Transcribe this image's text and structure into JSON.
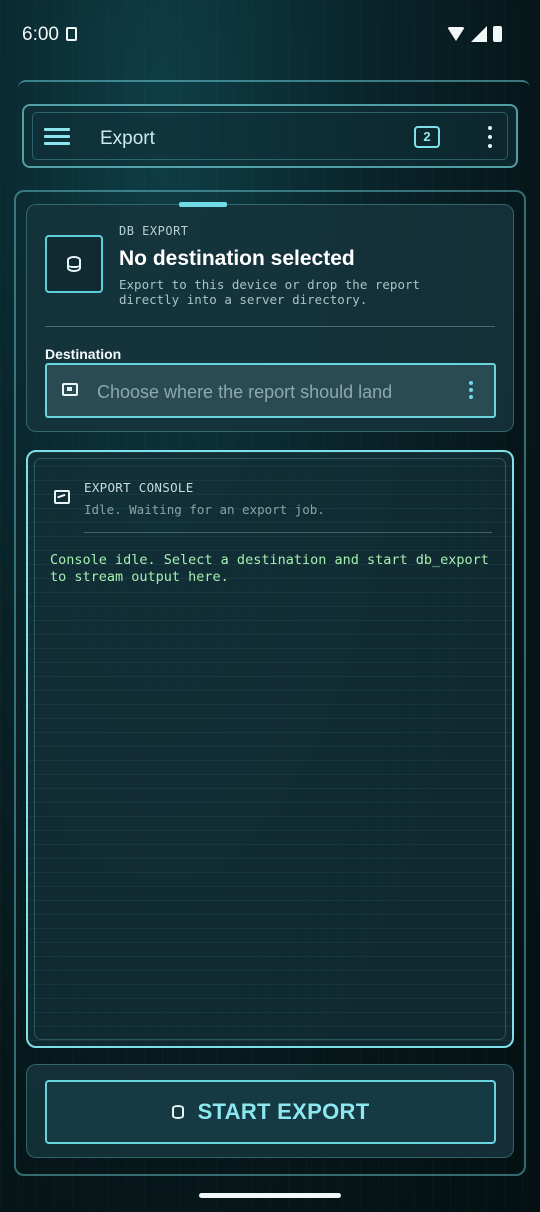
{
  "status_bar": {
    "time": "6:00"
  },
  "app_bar": {
    "title": "Export",
    "badge_count": "2"
  },
  "export_card": {
    "overline": "DB EXPORT",
    "title": "No destination selected",
    "description": "Export to this device or drop the report directly into a server directory.",
    "destination_label": "Destination",
    "destination_placeholder": "Choose where the report should land",
    "destination_value": ""
  },
  "console": {
    "title": "EXPORT CONSOLE",
    "status": "Idle. Waiting for an export job.",
    "output": "Console idle. Select a destination and start db_export to stream output here."
  },
  "actions": {
    "start_label": "START EXPORT"
  },
  "colors": {
    "accent": "#6fdce6",
    "console_text": "#a6f0b0",
    "background": "#0a262d"
  },
  "icons": {
    "menu": "menu-icon",
    "more": "more-vert-icon",
    "database": "database-icon",
    "folder": "folder-icon",
    "console": "terminal-icon"
  }
}
